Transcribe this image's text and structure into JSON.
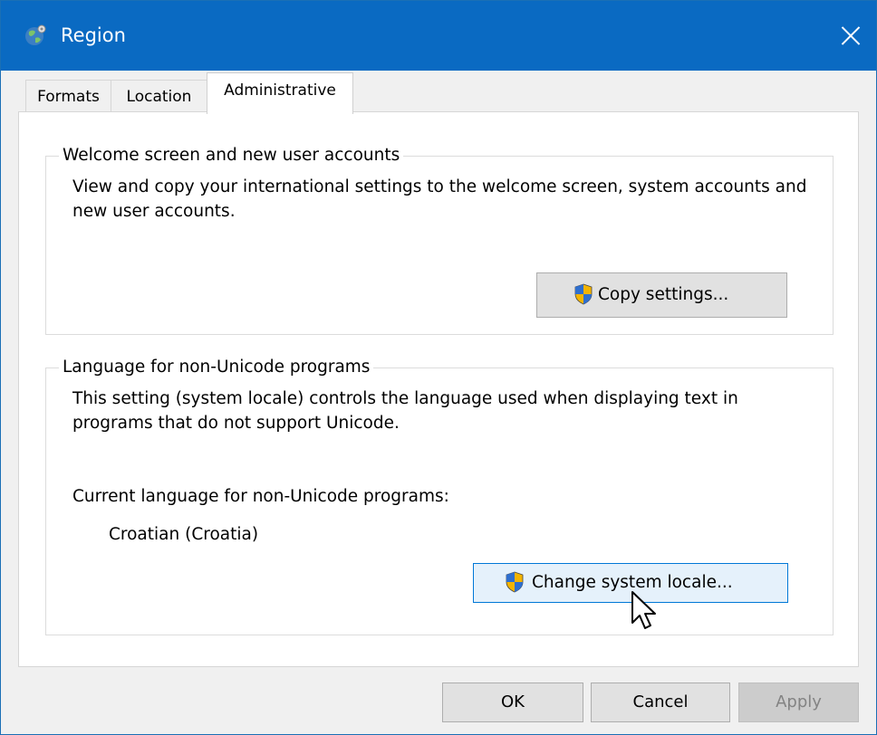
{
  "window": {
    "title": "Region",
    "icon": "globe-icon"
  },
  "tabs": [
    {
      "label": "Formats"
    },
    {
      "label": "Location"
    },
    {
      "label": "Administrative"
    }
  ],
  "welcome_group": {
    "title": "Welcome screen and new user accounts",
    "description": "View and copy your international settings to the welcome screen, system accounts and new user accounts.",
    "button": "Copy settings...",
    "button_icon": "uac-shield-icon"
  },
  "language_group": {
    "title": "Language for non-Unicode programs",
    "description": "This setting (system locale) controls the language used when displaying text in programs that do not support Unicode.",
    "current_label": "Current language for non-Unicode programs:",
    "current_value": "Croatian (Croatia)",
    "button": "Change system locale...",
    "button_icon": "uac-shield-icon"
  },
  "footer": {
    "ok": "OK",
    "cancel": "Cancel",
    "apply": "Apply"
  },
  "colors": {
    "titlebar": "#0a6ac2",
    "focus": "#0078d7"
  }
}
